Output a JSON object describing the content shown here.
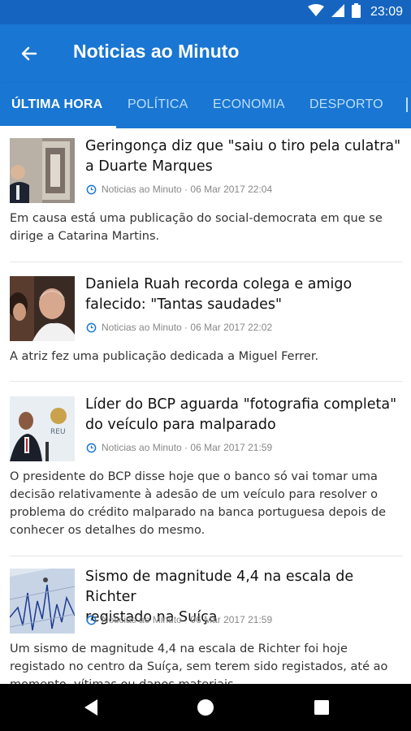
{
  "status_bar": {
    "time": "23:09",
    "icons": [
      "wifi-icon",
      "cellular-signal-icon",
      "battery-icon"
    ]
  },
  "app_bar": {
    "title": "Noticias ao Minuto",
    "back_icon": "arrow-left-icon"
  },
  "tabs": [
    {
      "label": "ÚLTIMA HORA",
      "active": true
    },
    {
      "label": "POLÍTICA",
      "active": false
    },
    {
      "label": "ECONOMIA",
      "active": false
    },
    {
      "label": "DESPORTO",
      "active": false
    }
  ],
  "articles": [
    {
      "headline_lines": [
        "Geringonça diz que \"saiu o tiro pela culatra\"",
        "a Duarte Marques"
      ],
      "source": "Noticias ao Minuto",
      "timestamp": "06 Mar 2017 22:04",
      "summary_lines": [
        "Em causa está uma publicação do social-democrata em que se",
        "dirige a Catarina Martins."
      ]
    },
    {
      "headline_lines": [
        "Daniela Ruah recorda colega e amigo",
        "falecido: \"Tantas saudades\""
      ],
      "source": "Noticias ao Minuto",
      "timestamp": "06 Mar 2017 22:02",
      "summary_lines": [
        "A atriz fez uma publicação dedicada a Miguel Ferrer."
      ]
    },
    {
      "headline_lines": [
        "Líder do BCP aguarda \"fotografia completa\"",
        "do veículo para malparado"
      ],
      "source": "Noticias ao Minuto",
      "timestamp": "06 Mar 2017 21:59",
      "summary_lines": [
        "O presidente do BCP disse hoje que o banco só vai tomar uma",
        "decisão relativamente à adesão de um veículo para resolver o",
        "problema do crédito malparado na banca portuguesa depois de",
        "conhecer os detalhes do mesmo."
      ]
    },
    {
      "headline_lines": [
        "Sismo de magnitude 4,4 na escala de Richter",
        "registado na Suíça"
      ],
      "source": "Noticias ao Minuto",
      "timestamp": "06 Mar 2017 21:59",
      "summary_lines": [
        "Um sismo de magnitude 4,4 na escala de Richter foi hoje",
        "registado no centro da Suíça, sem terem sido registados, até ao",
        "momento, vítimas ou danos materiais."
      ]
    }
  ],
  "meta_separator": " · ",
  "nav_bar": {
    "icons": [
      "back-triangle-icon",
      "home-circle-icon",
      "recents-square-icon"
    ]
  },
  "colors": {
    "status_bar": "#1565c0",
    "app_bar": "#1976d2",
    "tab_inactive": "#bbdefb",
    "meta_icon": "#1976d2"
  }
}
